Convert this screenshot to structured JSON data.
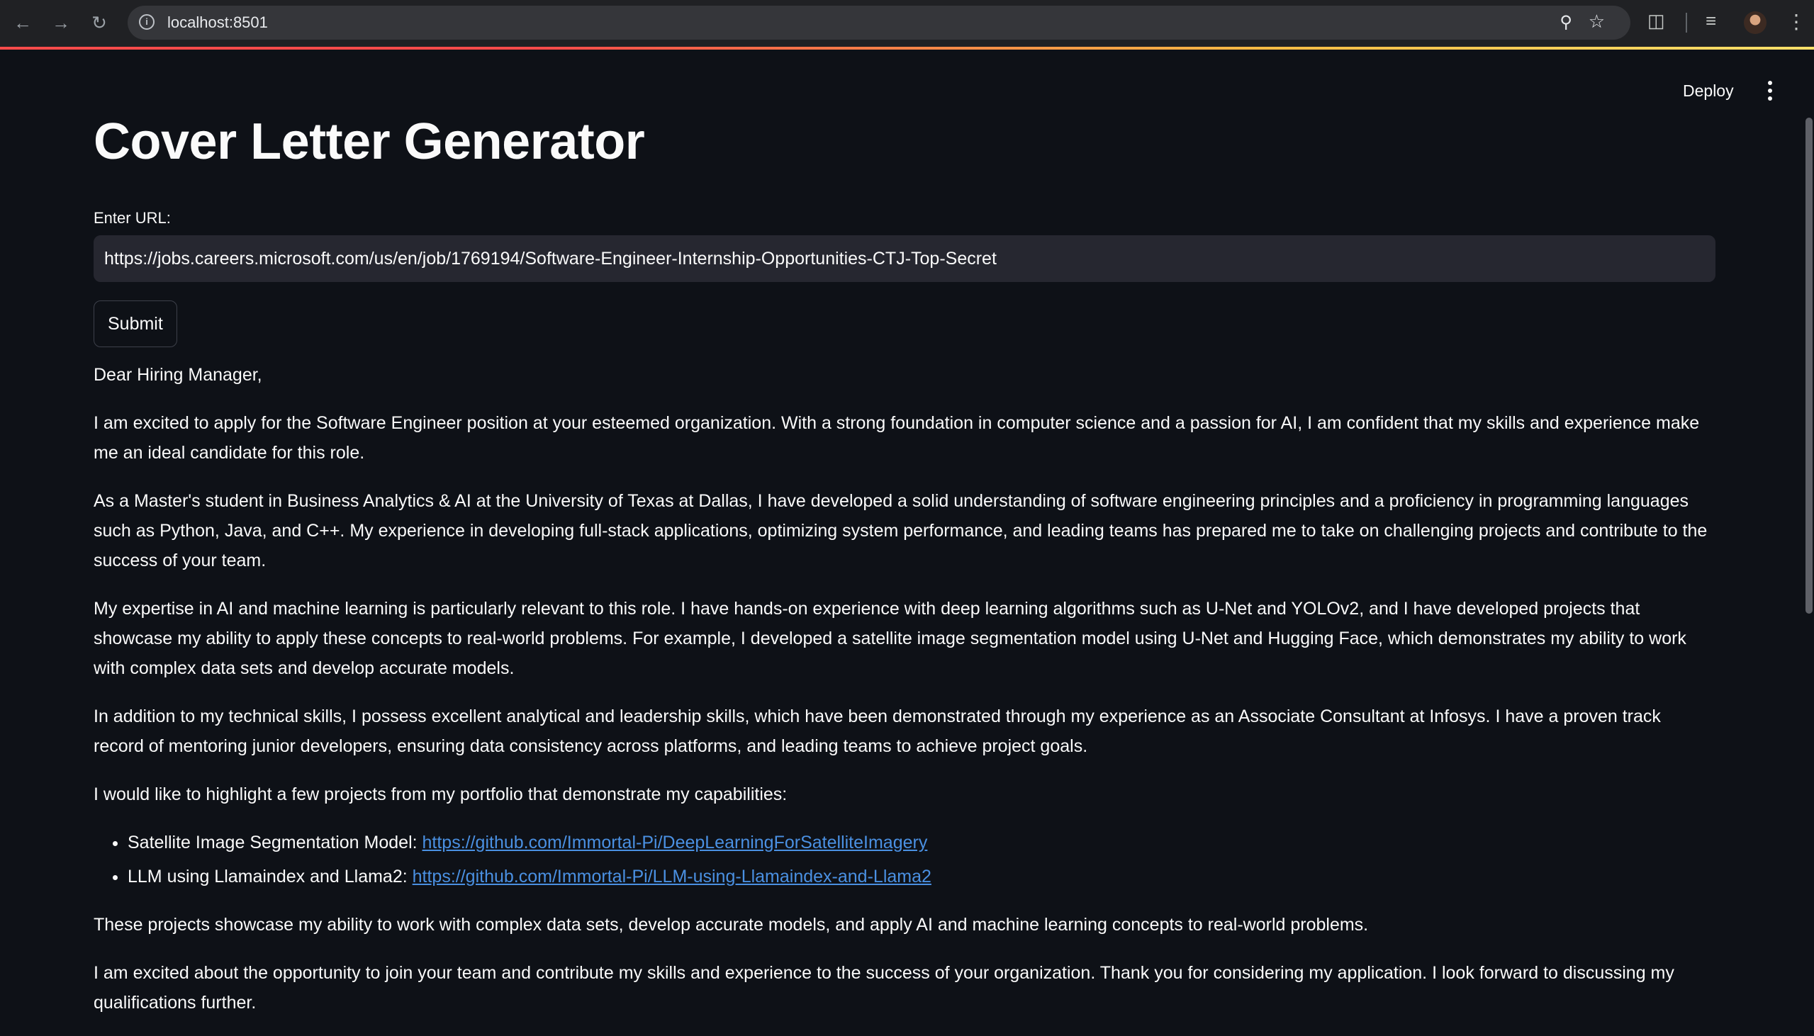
{
  "browser": {
    "url": "localhost:8501",
    "icons": [
      "back-icon",
      "forward-icon",
      "reload-icon",
      "site-info-icon",
      "zoom-icon",
      "bookmark-star-icon",
      "extensions-icon",
      "media-controls-icon",
      "profile-avatar",
      "chrome-menu-icon"
    ]
  },
  "header": {
    "deploy_label": "Deploy"
  },
  "main": {
    "title": "Cover Letter Generator",
    "url_label": "Enter URL:",
    "url_value": "https://jobs.careers.microsoft.com/us/en/job/1769194/Software-Engineer-Internship-Opportunities-CTJ-Top-Secret",
    "submit_label": "Submit"
  },
  "letter": {
    "greeting": "Dear Hiring Manager,",
    "p1": "I am excited to apply for the Software Engineer position at your esteemed organization. With a strong foundation in computer science and a passion for AI, I am confident that my skills and experience make me an ideal candidate for this role.",
    "p2": "As a Master's student in Business Analytics & AI at the University of Texas at Dallas, I have developed a solid understanding of software engineering principles and a proficiency in programming languages such as Python, Java, and C++. My experience in developing full-stack applications, optimizing system performance, and leading teams has prepared me to take on challenging projects and contribute to the success of your team.",
    "p3": "My expertise in AI and machine learning is particularly relevant to this role. I have hands-on experience with deep learning algorithms such as U-Net and YOLOv2, and I have developed projects that showcase my ability to apply these concepts to real-world problems. For example, I developed a satellite image segmentation model using U-Net and Hugging Face, which demonstrates my ability to work with complex data sets and develop accurate models.",
    "p4": "In addition to my technical skills, I possess excellent analytical and leadership skills, which have been demonstrated through my experience as an Associate Consultant at Infosys. I have a proven track record of mentoring junior developers, ensuring data consistency across platforms, and leading teams to achieve project goals.",
    "p5": "I would like to highlight a few projects from my portfolio that demonstrate my capabilities:",
    "projects": [
      {
        "label": "Satellite Image Segmentation Model: ",
        "link": "https://github.com/Immortal-Pi/DeepLearningForSatelliteImagery"
      },
      {
        "label": "LLM using Llamaindex and Llama2: ",
        "link": "https://github.com/Immortal-Pi/LLM-using-Llamaindex-and-Llama2"
      }
    ],
    "p6": "These projects showcase my ability to work with complex data sets, develop accurate models, and apply AI and machine learning concepts to real-world problems.",
    "p7": "I am excited about the opportunity to join your team and contribute my skills and experience to the success of your organization. Thank you for considering my application. I look forward to discussing my qualifications further."
  },
  "colors": {
    "background": "#0e1117",
    "input_bg": "#262730",
    "link": "#4a90e2",
    "accent_gradient_start": "#ff4b4b",
    "accent_gradient_end": "#ffe06a"
  }
}
